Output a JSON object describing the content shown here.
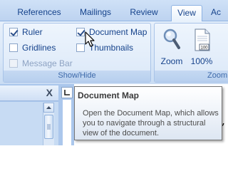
{
  "tabs": [
    {
      "label": "References",
      "active": false
    },
    {
      "label": "Mailings",
      "active": false
    },
    {
      "label": "Review",
      "active": false
    },
    {
      "label": "View",
      "active": true
    },
    {
      "label": "Ac",
      "active": false
    }
  ],
  "show_hide": {
    "group_label": "Show/Hide",
    "ruler": {
      "label": "Ruler",
      "checked": true
    },
    "gridlines": {
      "label": "Gridlines",
      "checked": false
    },
    "message_bar": {
      "label": "Message Bar",
      "checked": false,
      "disabled": true
    },
    "document_map": {
      "label": "Document Map",
      "checked": true
    },
    "thumbnails": {
      "label": "Thumbnails",
      "checked": false
    }
  },
  "zoom": {
    "group_label": "Zoom",
    "zoom_label": "Zoom",
    "zoom_100_label": "100%",
    "zoom_icon_page_text": "100"
  },
  "pane": {
    "close_glyph": "X"
  },
  "tooltip": {
    "title": "Document Map",
    "body": "Open the Document Map, which allows you to navigate through a structural view of the document."
  },
  "colors": {
    "ribbon_text": "#15428b",
    "group_label_text": "#3e6aaa",
    "tooltip_text": "#4c4c4c"
  }
}
